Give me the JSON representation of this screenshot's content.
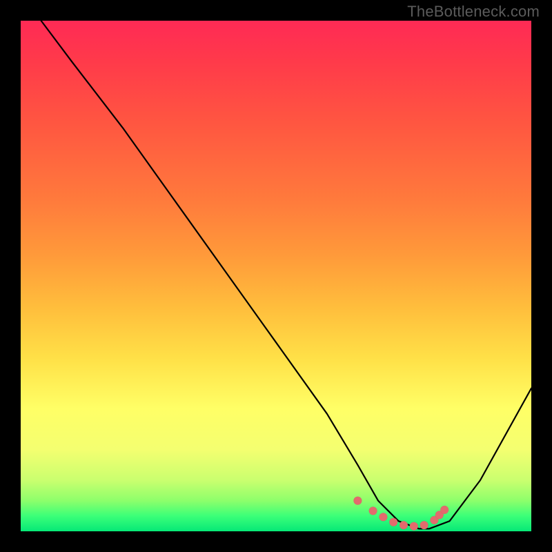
{
  "watermark": "TheBottleneck.com",
  "chart_data": {
    "type": "line",
    "title": "",
    "xlabel": "",
    "ylabel": "",
    "xlim": [
      0,
      100
    ],
    "ylim": [
      0,
      100
    ],
    "grid": false,
    "legend": false,
    "series": [
      {
        "name": "bottleneck-curve",
        "x": [
          4,
          10,
          20,
          30,
          40,
          50,
          60,
          66,
          70,
          74,
          78,
          80,
          84,
          90,
          100
        ],
        "y": [
          100,
          92,
          79,
          65,
          51,
          37,
          23,
          13,
          6,
          2,
          0.5,
          0.5,
          2,
          10,
          28
        ]
      }
    ],
    "markers": [
      {
        "name": "optimal-range-dots",
        "x": [
          66,
          69,
          71,
          73,
          75,
          77,
          79,
          81,
          82,
          83
        ],
        "y": [
          6,
          4,
          2.8,
          1.8,
          1.2,
          1.0,
          1.2,
          2.2,
          3.2,
          4.2
        ]
      }
    ],
    "colors": {
      "curve": "#000000",
      "dots": "#e26b6d",
      "gradient_top": "#ff2a55",
      "gradient_mid": "#ffe047",
      "gradient_bottom": "#06e877"
    }
  }
}
